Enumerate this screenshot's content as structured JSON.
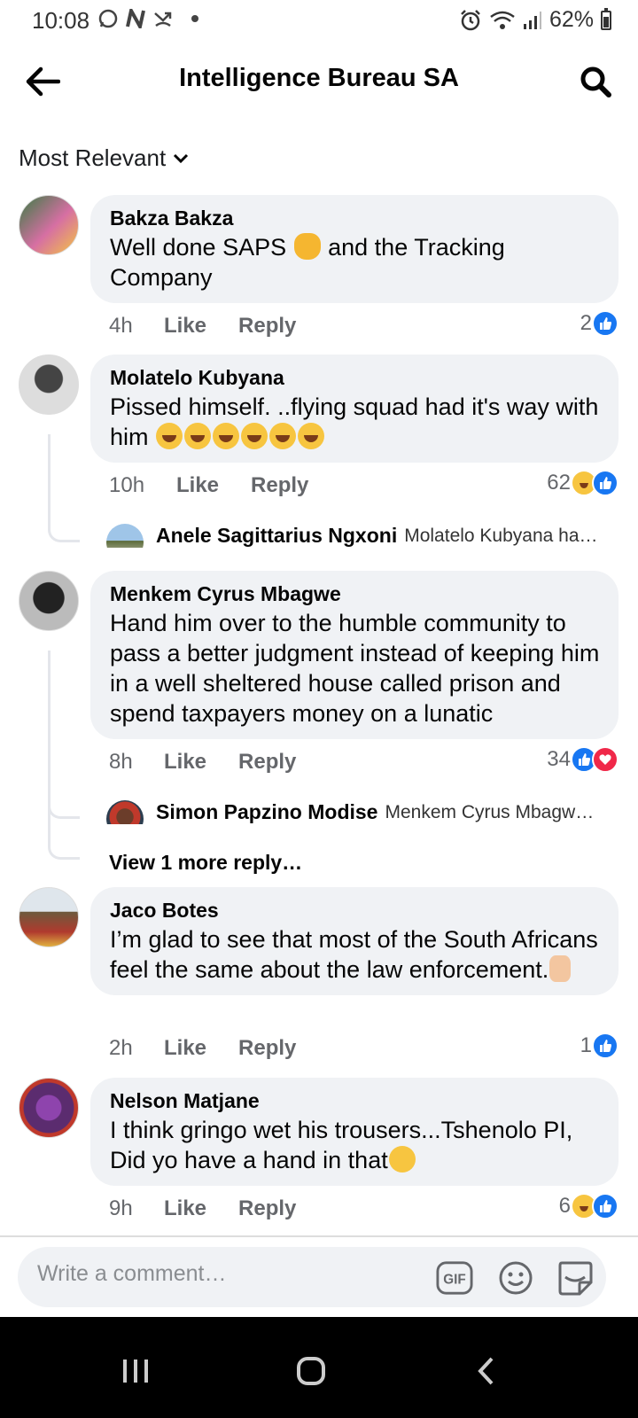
{
  "status_bar": {
    "time": "10:08",
    "battery": "62%",
    "battery_level": 0.62
  },
  "header": {
    "title": "Intelligence Bureau SA",
    "back_icon": "arrow-left-icon",
    "search_icon": "search-icon"
  },
  "sort": {
    "label": "Most Relevant"
  },
  "comments": [
    {
      "name": "Bakza Bakza",
      "text_a": "Well done SAPS ",
      "text_b": " and the Tracking Company",
      "time": "4h",
      "like": "Like",
      "reply": "Reply",
      "react_count": "2",
      "reactions": [
        "like"
      ]
    },
    {
      "name": "Molatelo Kubyana",
      "text": "Pissed himself. ..flying squad had it's  way with him ",
      "time": "10h",
      "like": "Like",
      "reply": "Reply",
      "react_count": "62",
      "reactions": [
        "haha",
        "like"
      ],
      "reply_preview": {
        "name": "Anele Sagittarius Ngxoni",
        "text": "Molatelo Kubyana ha…"
      }
    },
    {
      "name": "Menkem Cyrus Mbagwe",
      "text": "Hand him over to the humble community to pass a better judgment instead of keeping him in a well sheltered house called prison and spend taxpayers money on a  lunatic",
      "time": "8h",
      "like": "Like",
      "reply": "Reply",
      "react_count": "34",
      "reactions": [
        "like",
        "love"
      ],
      "reply_preview": {
        "name": "Simon Papzino Modise",
        "text": "Menkem Cyrus Mbagw…"
      },
      "view_more": "View 1 more reply…"
    },
    {
      "name": "Jaco Botes",
      "text": "I’m glad to see that most of the South Africans feel the same about the law enforcement.",
      "time": "2h",
      "like": "Like",
      "reply": "Reply",
      "react_count": "1",
      "reactions": [
        "like"
      ]
    },
    {
      "name": "Nelson Matjane",
      "text": "I think gringo wet his trousers...Tshenolo PI, Did yo have a hand in that",
      "time": "9h",
      "like": "Like",
      "reply": "Reply",
      "react_count": "6",
      "reactions": [
        "haha",
        "like"
      ]
    }
  ],
  "composer": {
    "placeholder": "Write a comment…",
    "gif_label": "GIF"
  },
  "colors": {
    "accent": "#1877f2",
    "bubble": "#f0f2f5",
    "love": "#f02849",
    "haha": "#f7c540"
  }
}
